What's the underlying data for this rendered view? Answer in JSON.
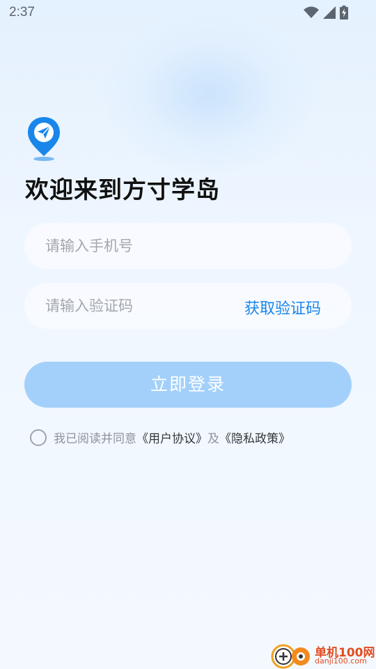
{
  "status_bar": {
    "time": "2:37",
    "icons": [
      "wifi-icon",
      "signal-icon",
      "battery-charging-icon"
    ]
  },
  "logo": {
    "icon": "map-pin-paper-plane-icon",
    "color": "#1a86ea"
  },
  "welcome_title": "欢迎来到方寸学岛",
  "form": {
    "phone_placeholder": "请输入手机号",
    "phone_value": "",
    "code_placeholder": "请输入验证码",
    "code_value": "",
    "get_code_label": "获取验证码",
    "login_label": "立即登录"
  },
  "agreement": {
    "prefix": "我已阅读并同意",
    "user_agreement": "《用户协议》",
    "and": "及",
    "privacy_policy": "《隐私政策》",
    "checked": false
  },
  "watermark": {
    "name": "单机100网",
    "url": "danji100.com"
  },
  "colors": {
    "accent": "#1a86ea",
    "button_disabled": "#a3d0fb",
    "watermark": "#e24c21"
  }
}
